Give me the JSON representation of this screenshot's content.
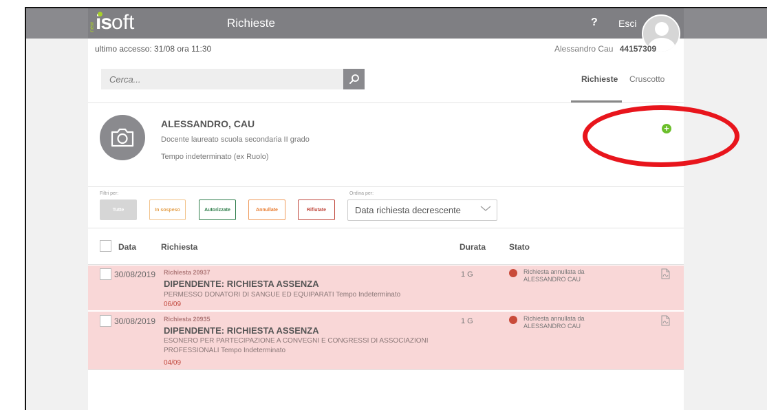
{
  "header": {
    "logo_prefix": "new",
    "logo_main": "is",
    "logo_suffix": "oft",
    "title": "Richieste",
    "help_label": "?",
    "logout_label": "Esci"
  },
  "session": {
    "last_access": "ultimo accesso: 31/08 ora 11:30",
    "user_name": "Alessandro Cau",
    "user_code": "44157309"
  },
  "search": {
    "placeholder": "Cerca...",
    "icon": "search-icon"
  },
  "tabs": [
    {
      "label": "Richieste",
      "active": true
    },
    {
      "label": "Cruscotto",
      "active": false
    }
  ],
  "profile": {
    "name": "ALESSANDRO, CAU",
    "role": "Docente laureato scuola secondaria II grado",
    "contract": "Tempo indeterminato (ex Ruolo)",
    "add_icon": "plus-circle-icon"
  },
  "filters": {
    "label": "Filtri per:",
    "buttons": [
      {
        "label": "Tutte"
      },
      {
        "label": "In sospeso"
      },
      {
        "label": "Autorizzate"
      },
      {
        "label": "Annullate"
      },
      {
        "label": "Rifiutate"
      }
    ],
    "sort_label": "Ordina per:",
    "sort_value": "Data richiesta decrescente"
  },
  "table": {
    "headers": {
      "data": "Data",
      "richiesta": "Richiesta",
      "durata": "Durata",
      "stato": "Stato"
    },
    "rows": [
      {
        "date": "30/08/2019",
        "id": "Richiesta 20937",
        "title": "DIPENDENTE: RICHIESTA ASSENZA",
        "description": "PERMESSO DONATORI DI SANGUE ED EQUIPARATI Tempo Indeterminato",
        "day": "06/09",
        "duration": "1 G",
        "status": "Richiesta annullata da ALESSANDRO CAU"
      },
      {
        "date": "30/08/2019",
        "id": "Richiesta 20935",
        "title": "DIPENDENTE: RICHIESTA ASSENZA",
        "description": "ESONERO PER PARTECIPAZIONE A CONVEGNI E CONGRESSI DI ASSOCIAZIONI PROFESSIONALI Tempo Indeterminato",
        "day": "04/09",
        "duration": "1 G",
        "status": "Richiesta annullata da ALESSANDRO CAU"
      }
    ]
  },
  "colors": {
    "header_bg": "#8a8a8e",
    "row_bg": "#f9d7d7",
    "status_cancelled": "#c94b3a",
    "accent_green": "#6cbf2c",
    "annotation_red": "#e8151c"
  }
}
